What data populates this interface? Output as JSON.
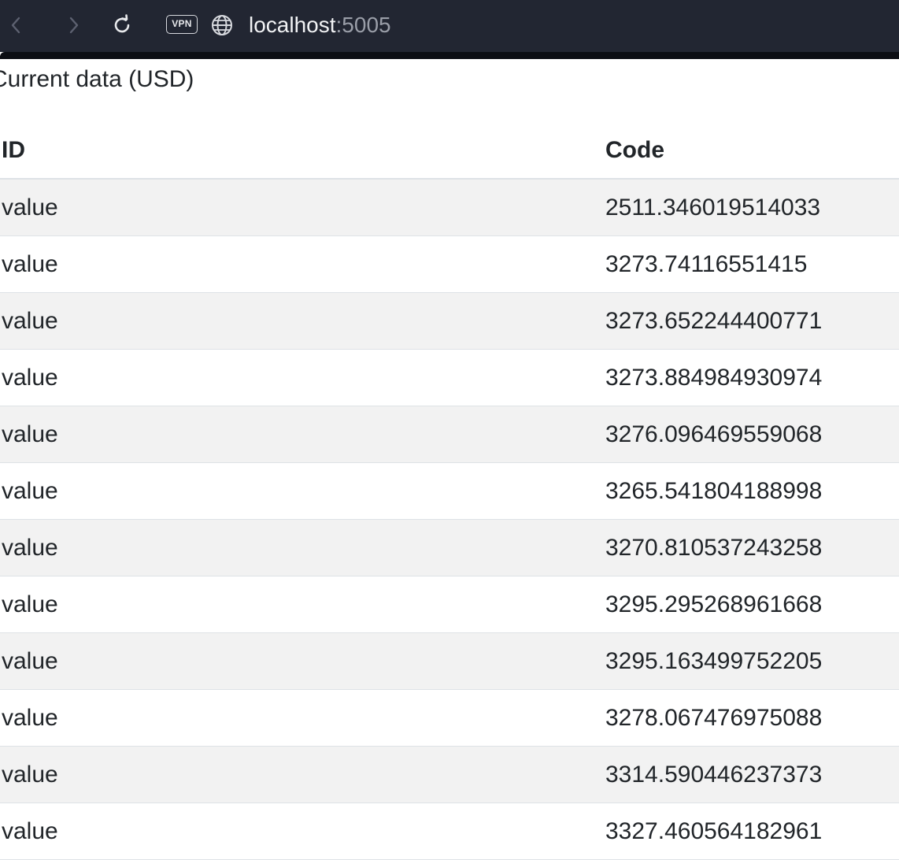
{
  "browser": {
    "url_host": "localhost",
    "url_port": ":5005",
    "vpn_label": "VPN",
    "icons": [
      "back-icon",
      "forward-icon",
      "reload-icon",
      "globe-icon"
    ]
  },
  "page": {
    "caption": "Current data (USD)"
  },
  "table": {
    "headers": {
      "id": "ID",
      "code": "Code"
    },
    "rows": [
      {
        "id": "value",
        "code": "2511.346019514033"
      },
      {
        "id": "value",
        "code": "3273.74116551415"
      },
      {
        "id": "value",
        "code": "3273.652244400771"
      },
      {
        "id": "value",
        "code": "3273.884984930974"
      },
      {
        "id": "value",
        "code": "3276.096469559068"
      },
      {
        "id": "value",
        "code": "3265.541804188998"
      },
      {
        "id": "value",
        "code": "3270.810537243258"
      },
      {
        "id": "value",
        "code": "3295.295268961668"
      },
      {
        "id": "value",
        "code": "3295.163499752205"
      },
      {
        "id": "value",
        "code": "3278.067476975088"
      },
      {
        "id": "value",
        "code": "3314.590446237373"
      },
      {
        "id": "value",
        "code": "3327.460564182961"
      }
    ]
  }
}
